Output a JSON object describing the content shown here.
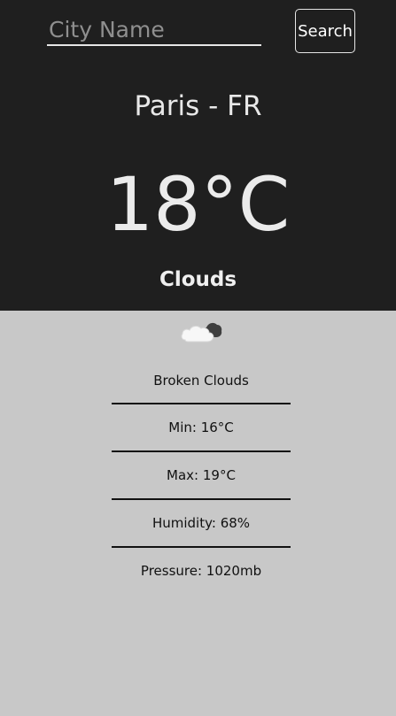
{
  "search": {
    "placeholder": "City Name",
    "value": "",
    "button_label": "Search"
  },
  "weather": {
    "location": "Paris - FR",
    "temperature": "18°C",
    "condition": "Clouds",
    "icon": "broken-clouds-icon",
    "details": [
      "Broken Clouds",
      "Min: 16°C",
      "Max: 19°C",
      "Humidity: 68%",
      "Pressure: 1020mb"
    ]
  },
  "colors": {
    "header_bg": "#1f1f1f",
    "body_bg": "#c8c8c8",
    "header_text": "#e8e8e8",
    "body_text": "#111111"
  }
}
